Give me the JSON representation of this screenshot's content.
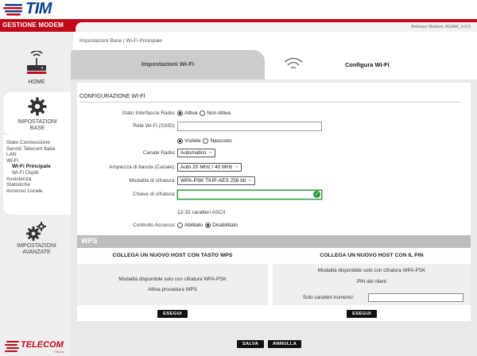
{
  "header": {
    "brand": "TIM",
    "section_title": "GESTIONE MODEM",
    "release": "Release Modem: AGAW_4.0.5"
  },
  "sidebar": {
    "home_label": "HOME",
    "base_label_line1": "IMPOSTAZIONI",
    "base_label_line2": "BASE",
    "items": [
      {
        "label": "Stato Connessione"
      },
      {
        "label": "Servizi Telecom Italia"
      },
      {
        "label": "LAN"
      },
      {
        "label": "Wi-Fi"
      },
      {
        "label": "Wi-Fi Principale"
      },
      {
        "label": "Wi-Fi Ospiti"
      },
      {
        "label": "Assistenza"
      },
      {
        "label": "Statistiche"
      },
      {
        "label": "Accesso Locale"
      }
    ],
    "advanced_label_line1": "IMPOSTAZIONI",
    "advanced_label_line2": "AVANZATE",
    "footer_brand": "TELECOM",
    "footer_sub": "ITALIA"
  },
  "breadcrumb": "Impostazioni Base   |   Wi-Fi Principale",
  "tabs": {
    "inactive": "Impostazioni Wi-Fi",
    "active": "Configura Wi-Fi"
  },
  "config": {
    "section_title": "CONFIGURAZIONE WI-FI",
    "stato_label": "Stato Interfaccia Radio:",
    "stato_opt1": "Attiva",
    "stato_opt2": "Non Attiva",
    "stato_selected": "Attiva",
    "ssid_label": "Rete Wi-Fi (SSID):",
    "ssid_value": "",
    "vis_opt1": "Visibile",
    "vis_opt2": "Nascosto",
    "vis_selected": "Visibile",
    "canale_label": "Canale Radio:",
    "canale_value": "Automatico",
    "banda_label": "Ampiezza di banda (Canale):",
    "banda_value": "Auto 20 MHz / 40 MHz",
    "cifratura_label": "Modalità di cifratura:",
    "cifratura_value": "WPA-PSK TKIP-AES 256 bit",
    "chiave_label": "Chiave di cifratura:",
    "chiave_value": "",
    "chiave_hint": "12-32 caratteri ASCII",
    "accesso_label": "Controllo Accesso:",
    "accesso_opt1": "Abilitato",
    "accesso_opt2": "Disabilitato",
    "accesso_selected": "Disabilitato"
  },
  "wps": {
    "title": "WPS",
    "left_title": "COLLEGA UN NUOVO HOST CON TASTO WPS",
    "left_line1": "Modalità disponibile solo con cifratura WPA-PSK",
    "left_line2": "Attiva procedura WPS",
    "left_button": "ESEGUI",
    "right_title": "COLLEGA UN NUOVO HOST CON IL PIN",
    "right_line1": "Modalità disponibile solo con cifratura WPA-PSK",
    "right_line2": "PIN del client",
    "right_pin_label": "Solo caratteri numerici:",
    "right_pin_value": "",
    "right_button": "ESEGUI"
  },
  "footer": {
    "save": "SALVA",
    "cancel": "ANNULLA"
  },
  "colors": {
    "brand_red": "#c00a1a",
    "brand_blue": "#0a3f8f",
    "valid_green": "#2f9a3a"
  }
}
